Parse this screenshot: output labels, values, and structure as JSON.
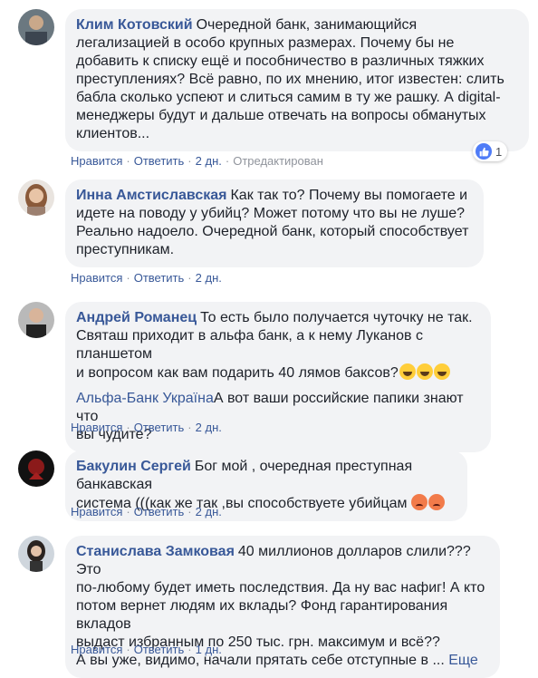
{
  "colors": {
    "name": "#385898",
    "bubble": "#f2f3f5",
    "meta": "#90949c",
    "like": "#4f7cf7"
  },
  "comments": [
    {
      "author": "Клим Котовский",
      "lines": [
        "Очередной банк, занимающийся",
        "легализацией в особо крупных размерах. Почему бы не",
        "добавить к списку ещё и пособничество в различных тяжких",
        "преступлениях? Всё равно, по их мнению, итог известен: слить",
        "бабла сколько успеют и слиться самим в ту же рашку. А digital-",
        "менеджеры будут и дальше отвечать на вопросы обманутых",
        "клиентов..."
      ],
      "like": "Нравится",
      "reply": "Ответить",
      "time": "2 дн.",
      "edited": "Отредактирован",
      "reaction_icon": "like-icon",
      "reaction_count": "1"
    },
    {
      "author": "Инна Амстиславская",
      "lines": [
        "Как так то? Почему вы помогаете и",
        "идете на поводу у убийц? Может потому что вы не луше?",
        "Реально надоело. Очередной банк, который способствует",
        "преступникам."
      ],
      "like": "Нравится",
      "reply": "Ответить",
      "time": "2 дн."
    },
    {
      "author": "Андрей Романец",
      "lines": [
        "То есть было получается чуточку не так.",
        "Святаш приходит в альфа банк, а к нему Луканов с планшетом",
        "и вопросом как вам подарить 40 лямов баксов?"
      ],
      "mention": "Альфа-Банк Україна",
      "mention_text": "А вот ваши российские папики знают что",
      "mention_text2": "вы чудите?",
      "emoji_icon": "laughing-emoji-icon",
      "like": "Нравится",
      "reply": "Ответить",
      "time": "2 дн."
    },
    {
      "author": "Бакулин Сергей",
      "lines": [
        "Бог мой , очередная преступная банкавская",
        "система (((как же так ,вы способствуете убийцам"
      ],
      "emoji_icon": "angry-emoji-icon",
      "like": "Нравится",
      "reply": "Ответить",
      "time": "2 дн."
    },
    {
      "author": "Станислава Замковая",
      "lines": [
        "40 миллионов долларов слили??? Это",
        "по-любому будет иметь последствия. Да ну вас нафиг! А кто",
        "потом вернет людям их вклады? Фонд гарантирования вкладов",
        "выдаст избранным по 250 тыс. грн. максимум и всё??",
        "А вы уже, видимо, начали прятать себе отступные в ..."
      ],
      "more": "Еще",
      "like": "Нравится",
      "reply": "Ответить",
      "time": "1 дн."
    }
  ]
}
